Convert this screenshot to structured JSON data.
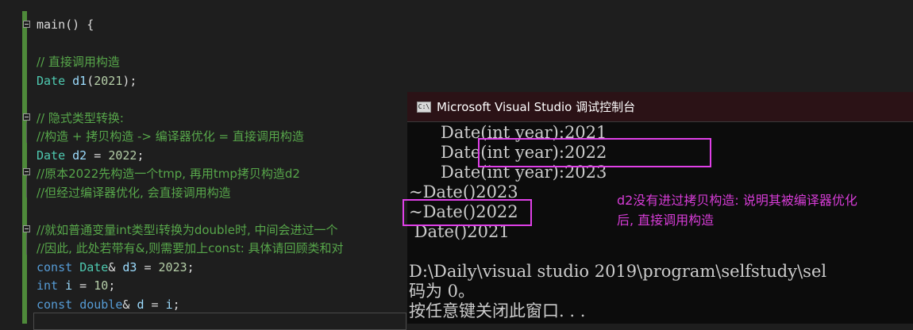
{
  "editor": {
    "lines": [
      [
        {
          "t": "main() {",
          "c": "pl"
        }
      ],
      [],
      [
        {
          "t": "// 直接调用构造",
          "c": "cm"
        }
      ],
      [
        {
          "t": "Date",
          "c": "ty"
        },
        {
          "t": " ",
          "c": "pl"
        },
        {
          "t": "d1",
          "c": "id"
        },
        {
          "t": "(",
          "c": "pl"
        },
        {
          "t": "2021",
          "c": "nm"
        },
        {
          "t": ");",
          "c": "pl"
        }
      ],
      [],
      [
        {
          "t": "// 隐式类型转换:",
          "c": "cm"
        }
      ],
      [
        {
          "t": "//构造 + 拷贝构造 -> 编译器优化 = 直接调用构造",
          "c": "cm"
        }
      ],
      [
        {
          "t": "Date",
          "c": "ty"
        },
        {
          "t": " ",
          "c": "pl"
        },
        {
          "t": "d2",
          "c": "id"
        },
        {
          "t": " = ",
          "c": "pl"
        },
        {
          "t": "2022",
          "c": "nm"
        },
        {
          "t": ";",
          "c": "pl"
        }
      ],
      [
        {
          "t": "//原本2022先构造一个tmp, 再用tmp拷贝构造d2",
          "c": "cm"
        }
      ],
      [
        {
          "t": "//但经过编译器优化, 会直接调用构造",
          "c": "cm"
        }
      ],
      [],
      [
        {
          "t": "//就如普通变量int类型i转换为double时, 中间会进过一个",
          "c": "cm"
        }
      ],
      [
        {
          "t": "//因此, 此处若带有&,则需要加上const: 具体请回顾类和对",
          "c": "cm"
        }
      ],
      [
        {
          "t": "const",
          "c": "kw"
        },
        {
          "t": " ",
          "c": "pl"
        },
        {
          "t": "Date",
          "c": "ty"
        },
        {
          "t": "& ",
          "c": "pl"
        },
        {
          "t": "d3",
          "c": "id"
        },
        {
          "t": " = ",
          "c": "pl"
        },
        {
          "t": "2023",
          "c": "nm"
        },
        {
          "t": ";",
          "c": "pl"
        }
      ],
      [
        {
          "t": "int",
          "c": "kw"
        },
        {
          "t": " ",
          "c": "pl"
        },
        {
          "t": "i",
          "c": "id"
        },
        {
          "t": " = ",
          "c": "pl"
        },
        {
          "t": "10",
          "c": "nm"
        },
        {
          "t": ";",
          "c": "pl"
        }
      ],
      [
        {
          "t": "const",
          "c": "kw"
        },
        {
          "t": " ",
          "c": "pl"
        },
        {
          "t": "double",
          "c": "kw"
        },
        {
          "t": "& ",
          "c": "pl"
        },
        {
          "t": "d",
          "c": "id"
        },
        {
          "t": " = ",
          "c": "pl"
        },
        {
          "t": "i",
          "c": "id"
        },
        {
          "t": ";",
          "c": "pl"
        }
      ]
    ]
  },
  "console": {
    "title": "Microsoft Visual Studio 调试控制台",
    "icon": "console-app-icon",
    "icon_label": "C:\\",
    "output_lines": [
      "      Date(int year):2021",
      "      Date(int year):2022",
      "      Date(int year):2023",
      "~Date()2023",
      "~Date()2022",
      " Date()2021",
      "",
      "D:\\Daily\\visual studio 2019\\program\\selfstudy\\sel",
      "码为 0。",
      "按任意键关闭此窗口. . ."
    ]
  },
  "annotation": {
    "note_line1": "d2没有进过拷贝构造: 说明其被编译器优化",
    "note_line2": "后, 直接调用构造",
    "highlight_color": "#e040e8",
    "note_color": "#d63cd6"
  },
  "colors": {
    "editor_bg": "#1e1e1e",
    "keyword": "#569cd6",
    "type": "#4ec9b0",
    "identifier": "#9cdcfe",
    "number": "#b5cea8",
    "comment": "#57a64a",
    "console_bg": "#0c0c0c",
    "console_titlebar": "#2b1216"
  }
}
